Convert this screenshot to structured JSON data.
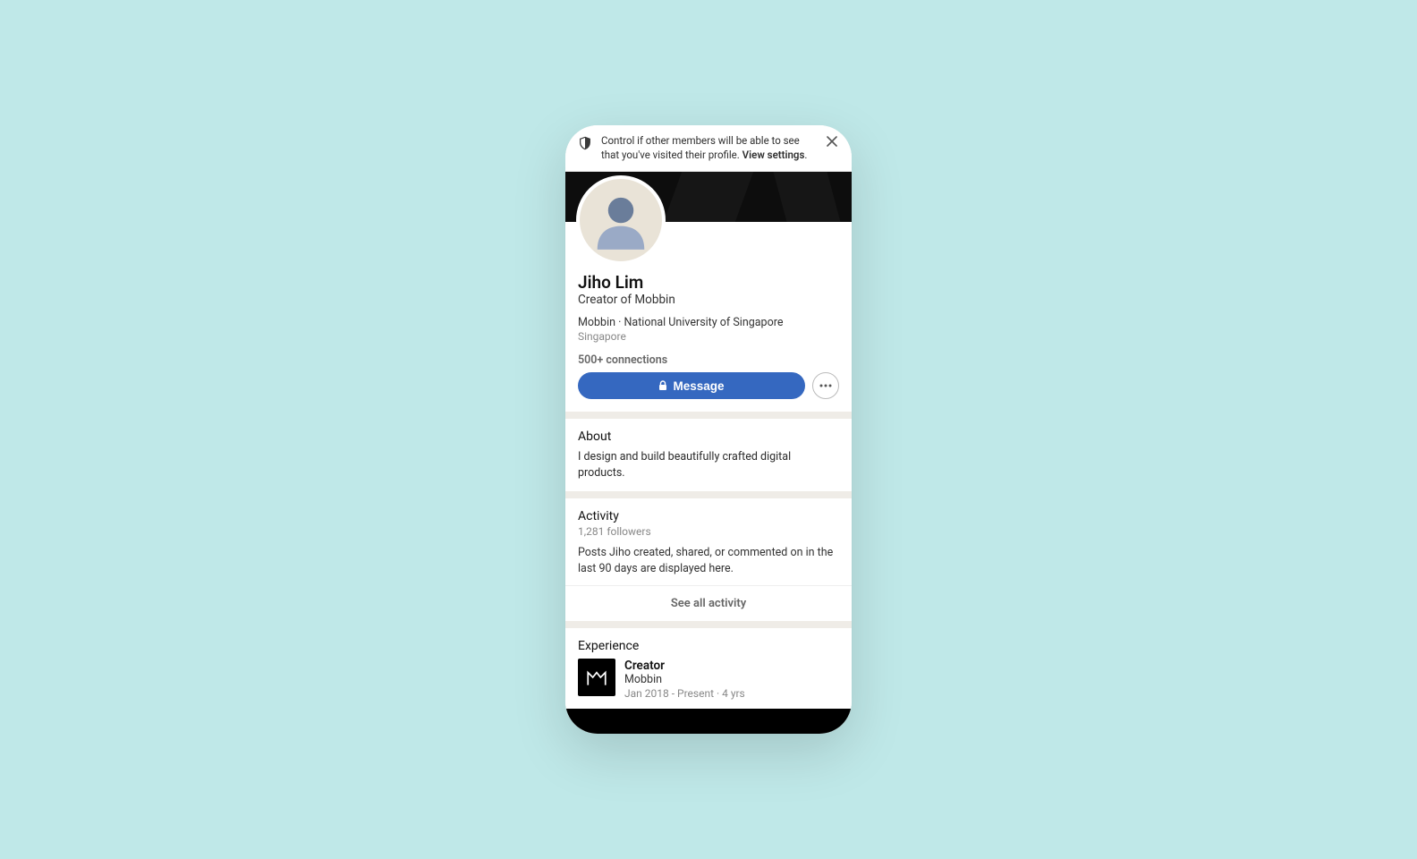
{
  "notice": {
    "text": "Control if other members will be able to see that you've visited their profile. ",
    "link": "View settings"
  },
  "profile": {
    "name": "Jiho Lim",
    "headline": "Creator of Mobbin",
    "org": "Mobbin · National University of Singapore",
    "location": "Singapore",
    "connections": "500+ connections",
    "message_btn": "Message"
  },
  "about": {
    "heading": "About",
    "text": "I design and build beautifully crafted digital products."
  },
  "activity": {
    "heading": "Activity",
    "followers": "1,281 followers",
    "text": "Posts Jiho created, shared, or commented on in the last 90 days are displayed here.",
    "see_all": "See all activity"
  },
  "experience": {
    "heading": "Experience",
    "items": [
      {
        "title": "Creator",
        "company": "Mobbin",
        "period": "Jan 2018 - Present",
        "duration": "4 yrs"
      }
    ]
  }
}
